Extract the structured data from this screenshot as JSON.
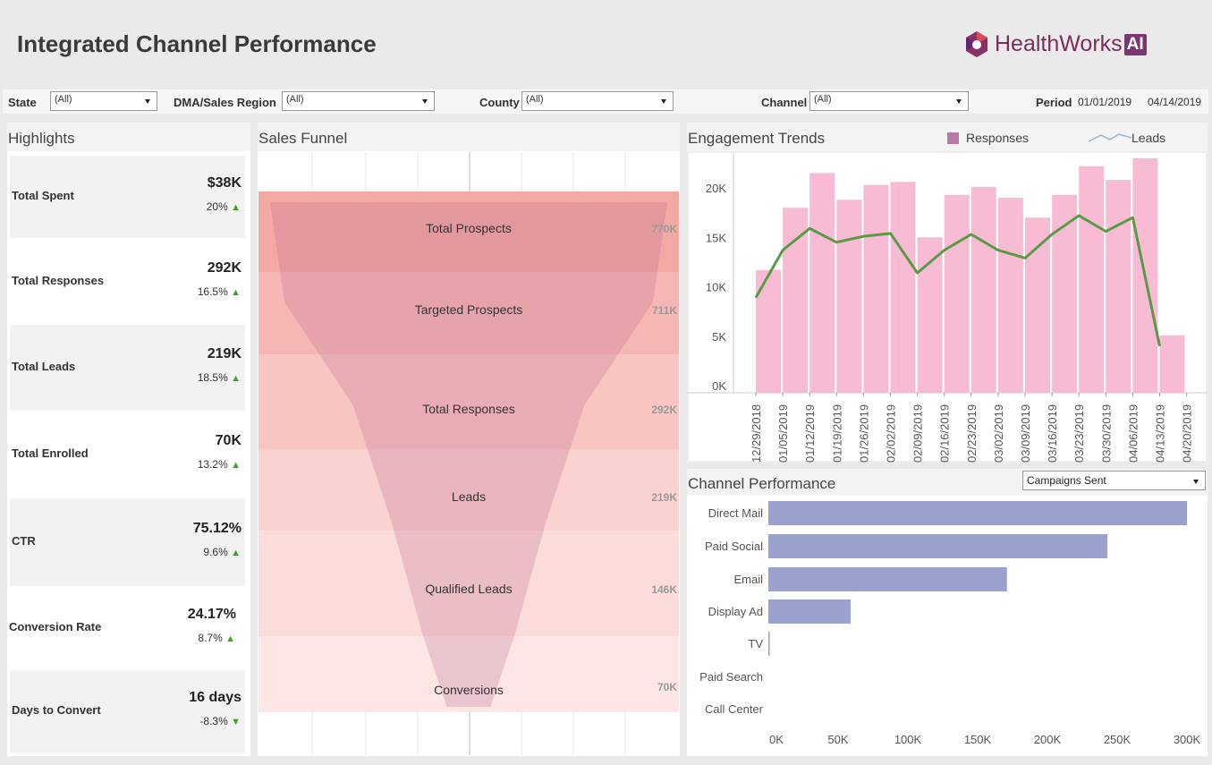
{
  "header": {
    "title": "Integrated Channel Performance",
    "logo_text": "HealthWorks",
    "logo_ai": "AI"
  },
  "filters": {
    "state_label": "State",
    "state_value": "(All)",
    "dma_label": "DMA/Sales Region",
    "dma_value": "(All)",
    "county_label": "County",
    "county_value": "(All)",
    "channel_label": "Channel",
    "channel_value": "(All)",
    "period_label": "Period",
    "period_start": "01/01/2019",
    "period_end": "04/14/2019"
  },
  "highlights": {
    "title": "Highlights",
    "items": [
      {
        "label": "Total Spent",
        "value": "$38K",
        "change": "20%",
        "dir": "▲"
      },
      {
        "label": "Total Responses",
        "value": "292K",
        "change": "16.5%",
        "dir": "▲"
      },
      {
        "label": "Total Leads",
        "value": "219K",
        "change": "18.5%",
        "dir": "▲"
      },
      {
        "label": "Total Enrolled",
        "value": "70K",
        "change": "13.2%",
        "dir": "▲"
      },
      {
        "label": "CTR",
        "value": "75.12%",
        "change": "9.6%",
        "dir": "▲"
      },
      {
        "label": "Conversion Rate",
        "value": "24.17%",
        "change": "8.7%",
        "dir": "▲"
      },
      {
        "label": "Days to Convert",
        "value": "16 days",
        "change": "-8.3%",
        "dir": "▼"
      }
    ]
  },
  "funnel": {
    "title": "Sales Funnel",
    "stages": [
      "Total Prospects",
      "Targeted Prospects",
      "Total Responses",
      "Leads",
      "Qualified Leads",
      "Conversions"
    ],
    "values_label": [
      "770K",
      "711K",
      "292K",
      "219K",
      "146K",
      "70K"
    ],
    "values": [
      770000,
      711000,
      292000,
      219000,
      146000,
      70000
    ]
  },
  "engagement": {
    "title": "Engagement Trends",
    "legend_responses": "Responses",
    "legend_leads": "Leads",
    "colors": {
      "responses": "#f7bcd4",
      "leads": "#5a9a44",
      "legend_responses": "#b57aa7"
    }
  },
  "channel": {
    "title": "Channel Performance",
    "metric_select": "Campaigns Sent",
    "bar_color": "#9ba1cf"
  },
  "chart_data": [
    {
      "type": "bar",
      "title": "Engagement Trends",
      "categories": [
        "12/29/2018",
        "01/05/2019",
        "01/12/2019",
        "01/19/2019",
        "01/26/2019",
        "02/02/2019",
        "02/09/2019",
        "02/16/2019",
        "02/23/2019",
        "03/02/2019",
        "03/09/2019",
        "03/16/2019",
        "03/23/2019",
        "03/30/2019",
        "04/06/2019",
        "04/13/2019",
        "04/20/2019"
      ],
      "series": [
        {
          "name": "Responses",
          "type": "bar",
          "values": [
            11700,
            18000,
            21500,
            18800,
            20300,
            20600,
            15000,
            19300,
            20100,
            19000,
            17000,
            19300,
            22200,
            20800,
            23000,
            5100,
            null
          ]
        },
        {
          "name": "Leads",
          "type": "line",
          "values": [
            8900,
            13700,
            15900,
            14500,
            15100,
            15400,
            11400,
            13700,
            15300,
            13700,
            12900,
            15300,
            17200,
            15600,
            17000,
            4000,
            null
          ]
        }
      ],
      "ylim": [
        0,
        24000
      ],
      "yticks": [
        0,
        5000,
        10000,
        15000,
        20000
      ],
      "ytick_labels": [
        "0K",
        "5K",
        "10K",
        "15K",
        "20K"
      ],
      "grid": false,
      "legend": "top-right"
    },
    {
      "type": "bar",
      "title": "Channel Performance",
      "categories": [
        "Direct Mail",
        "Paid Social",
        "Email",
        "Display Ad",
        "TV",
        "Paid Search",
        "Call Center"
      ],
      "values": [
        300000,
        243000,
        171000,
        59000,
        1000,
        0,
        0
      ],
      "xlim": [
        0,
        310000
      ],
      "xticks": [
        0,
        50000,
        100000,
        150000,
        200000,
        250000,
        300000
      ],
      "xtick_labels": [
        "0K",
        "50K",
        "100K",
        "150K",
        "200K",
        "250K",
        "300K"
      ]
    }
  ]
}
